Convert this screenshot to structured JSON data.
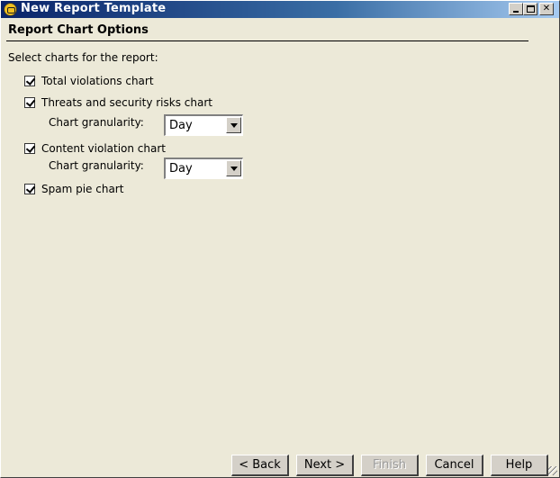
{
  "window": {
    "title": "New Report Template",
    "min_label": "",
    "max_label": "",
    "close_label": "✕"
  },
  "section": {
    "title": "Report Chart Options",
    "prompt": "Select charts for the report:"
  },
  "options": [
    {
      "label": "Total violations chart",
      "checked": true
    },
    {
      "label": "Threats and security risks chart",
      "checked": true
    },
    {
      "label": "Content violation chart",
      "checked": true
    },
    {
      "label": "Spam pie chart",
      "checked": true
    }
  ],
  "granularity": [
    {
      "label": "Chart granularity:",
      "value": "Day"
    },
    {
      "label": "Chart granularity:",
      "value": "Day"
    }
  ],
  "buttons": {
    "back": "< Back",
    "next": "Next >",
    "finish": "Finish",
    "cancel": "Cancel",
    "help": "Help"
  }
}
